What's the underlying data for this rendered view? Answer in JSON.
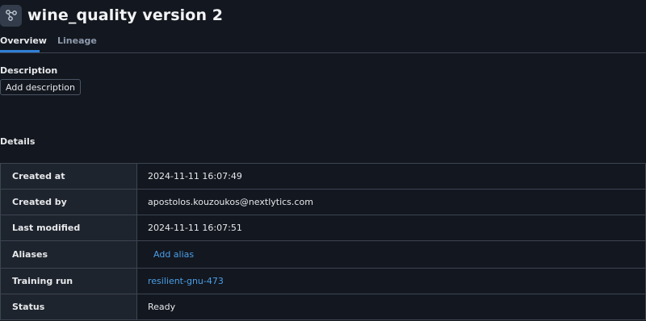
{
  "header": {
    "title": "wine_quality version 2",
    "icon": "model-graph-icon"
  },
  "tabs": [
    {
      "label": "Overview",
      "active": true
    },
    {
      "label": "Lineage",
      "active": false
    }
  ],
  "description": {
    "label": "Description",
    "button_label": "Add description"
  },
  "details": {
    "label": "Details",
    "rows": [
      {
        "key": "Created at",
        "value": "2024-11-11 16:07:49"
      },
      {
        "key": "Created by",
        "value": "apostolos.kouzoukos@nextlytics.com"
      },
      {
        "key": "Last modified",
        "value": "2024-11-11 16:07:51"
      },
      {
        "key": "Aliases",
        "value": "Add alias"
      },
      {
        "key": "Training run",
        "value": "resilient-gnu-473"
      },
      {
        "key": "Status",
        "value": "Ready"
      }
    ]
  },
  "colors": {
    "background": "#13171f",
    "accent": "#2f80d6",
    "link": "#4a9fe8"
  }
}
